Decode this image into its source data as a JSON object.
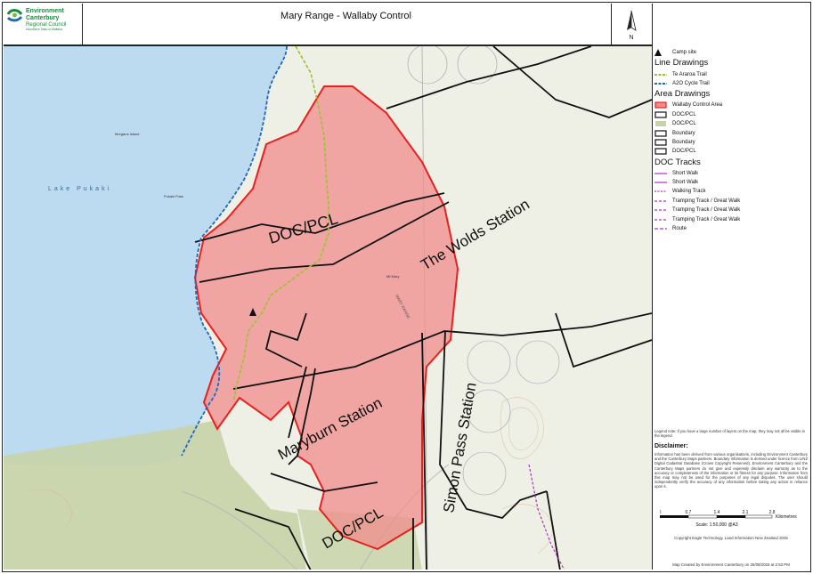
{
  "title": "Mary Range - Wallaby Control",
  "logo": {
    "line1": "Environment",
    "line2": "Canterbury",
    "line3": "Regional Council",
    "line4": "Kaunihera Taiao ki Waitaha"
  },
  "north_label": "N",
  "map_labels": {
    "lake": "Lake Pukaki",
    "doc_pcl_north": "DOC/PCL",
    "wolds_station": "The Wolds Station",
    "maryburn_station": "Maryburn Station",
    "simon_pass_station": "Simon Pass Station",
    "doc_pcl_south": "DOC/PCL",
    "mary_range": "MARY RANGE",
    "morgans_island": "Morgans Island",
    "pukaki_flats": "Pukaki Flats",
    "mt_mary": "Mt Mary"
  },
  "legend": {
    "camp_site": "Camp site",
    "line_drawings_heading": "Line Drawings",
    "line_items": [
      "Te Araroa Trail",
      "A2O Cycle Trail"
    ],
    "area_drawings_heading": "Area Drawings",
    "area_items": [
      "Wallaby Control Area",
      "DOC/PCL",
      "DOC/PCL",
      "Boundary",
      "Boundary",
      "DOC/PCL"
    ],
    "doc_tracks_heading": "DOC Tracks",
    "track_items": [
      "Short Walk",
      "Short Walk",
      "Walking Track",
      "Tramping Track / Great Walk",
      "Tramping Track / Great Walk",
      "Tramping Track / Great Walk",
      "Route"
    ]
  },
  "legend_note": "Legend note: if you have a large number of layers on the map, they may not all be visible in the legend.",
  "disclaimer_title": "Disclaimer:",
  "disclaimer_text": "Information has been derived from various organisations, including Environment Canterbury and the Canterbury Maps partners. Boundary information is derived under licence from LINZ Digital Cadastral Database (Crown Copyright Reserved). Environment Canterbury and the Canterbury Maps partners do not give and expressly disclaim any warranty as to the accuracy or completeness of the information or its fitness for any purpose. Information from this map may not be used for the purposes of any legal disputes. The user should independently verify the accuracy of any information before taking any action in reliance upon it.",
  "scale": {
    "ticks": [
      "0",
      "0.7",
      "1.4",
      "2.1",
      "2.8"
    ],
    "unit": "Kilometres",
    "label": "Scale: 1:50,000 @A3"
  },
  "copyright": "Copyright Eagle Technology, Land Information New Zealand 2026",
  "created": "Map Created by Environment Canterbury on 25/09/2026 at 2:53 PM",
  "colors": {
    "lake": "#bcdaf0",
    "land": "#eef0e8",
    "wallaby_area": "#f08c8c",
    "wallaby_border": "#e8201e",
    "doc_green": "#c6d3a8",
    "te_araroa": "#9bc232",
    "a2o": "#1f67c2",
    "track": "#b030c8"
  }
}
